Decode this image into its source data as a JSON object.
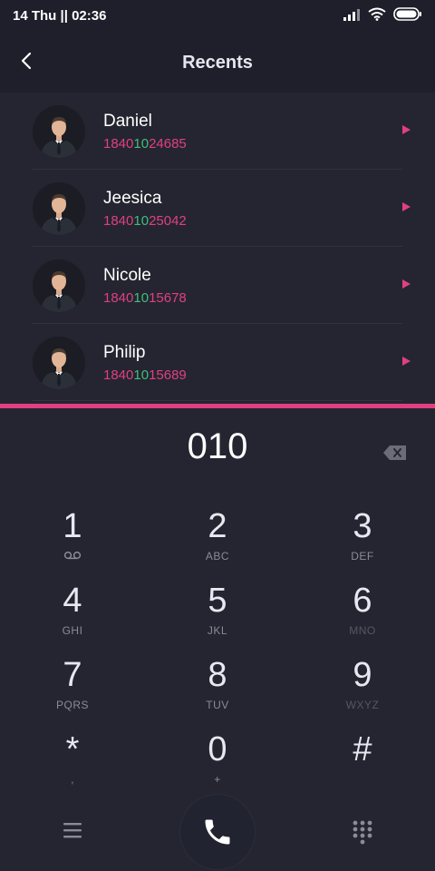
{
  "status_bar": {
    "time": "14 Thu || 02:36",
    "icons": [
      "signal-icon",
      "wifi-icon",
      "battery-icon"
    ]
  },
  "header": {
    "title": "Recents",
    "back_icon": "chevron-left-icon"
  },
  "contacts": [
    {
      "name": "Daniel",
      "number_prefix": "1840",
      "number_mid": "10",
      "number_suffix": "24685"
    },
    {
      "name": "Jeesica",
      "number_prefix": "1840",
      "number_mid": "10",
      "number_suffix": "25042"
    },
    {
      "name": "Nicole",
      "number_prefix": "1840",
      "number_mid": "10",
      "number_suffix": "15678"
    },
    {
      "name": "Philip",
      "number_prefix": "1840",
      "number_mid": "10",
      "number_suffix": "15689"
    }
  ],
  "dialer": {
    "input": "010",
    "keys": [
      {
        "digit": "1",
        "sub": ""
      },
      {
        "digit": "2",
        "sub": "ABC"
      },
      {
        "digit": "3",
        "sub": "DEF"
      },
      {
        "digit": "4",
        "sub": "GHI"
      },
      {
        "digit": "5",
        "sub": "JKL"
      },
      {
        "digit": "6",
        "sub": "MNO"
      },
      {
        "digit": "7",
        "sub": "PQRS"
      },
      {
        "digit": "8",
        "sub": "TUV"
      },
      {
        "digit": "9",
        "sub": "WXYZ"
      },
      {
        "digit": "*",
        "sub": ","
      },
      {
        "digit": "0",
        "sub": "+"
      },
      {
        "digit": "#",
        "sub": ""
      }
    ]
  },
  "colors": {
    "accent": "#e0407f",
    "highlight": "#3fbf7f",
    "background": "#242530",
    "header_bg": "#1e1f2a"
  }
}
